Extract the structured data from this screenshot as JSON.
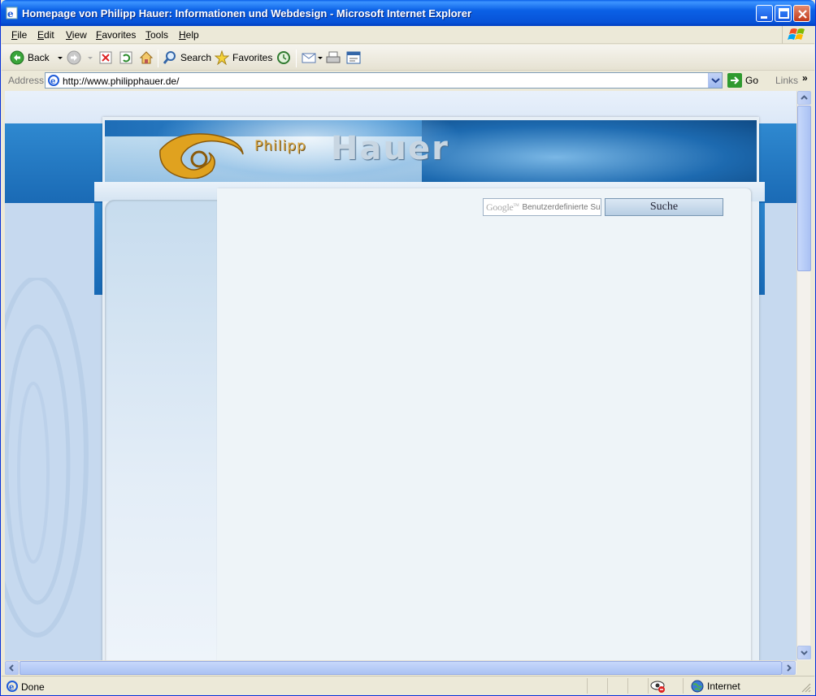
{
  "window": {
    "title": "Homepage von Philipp Hauer: Informationen und Webdesign - Microsoft Internet Explorer"
  },
  "menu": {
    "items": [
      "File",
      "Edit",
      "View",
      "Favorites",
      "Tools",
      "Help"
    ]
  },
  "toolbar": {
    "back_label": "Back",
    "search_label": "Search",
    "favorites_label": "Favorites"
  },
  "address": {
    "label": "Address",
    "url": "http://www.philipphauer.de/",
    "go_label": "Go",
    "links_label": "Links",
    "more": "»"
  },
  "page": {
    "brand_first": "Philipp",
    "brand_last": "Hauer",
    "search_logo": "Google",
    "search_logo_tm": "TM",
    "search_placeholder": "Benutzerdefinierte Suche",
    "search_button": "Suche"
  },
  "status": {
    "text": "Done",
    "zone": "Internet"
  },
  "colors": {
    "titlebar": "#0b61e6",
    "chrome": "#ece9d8",
    "page_blue": "#1a6ab5",
    "brand_gold": "#d9a847"
  }
}
